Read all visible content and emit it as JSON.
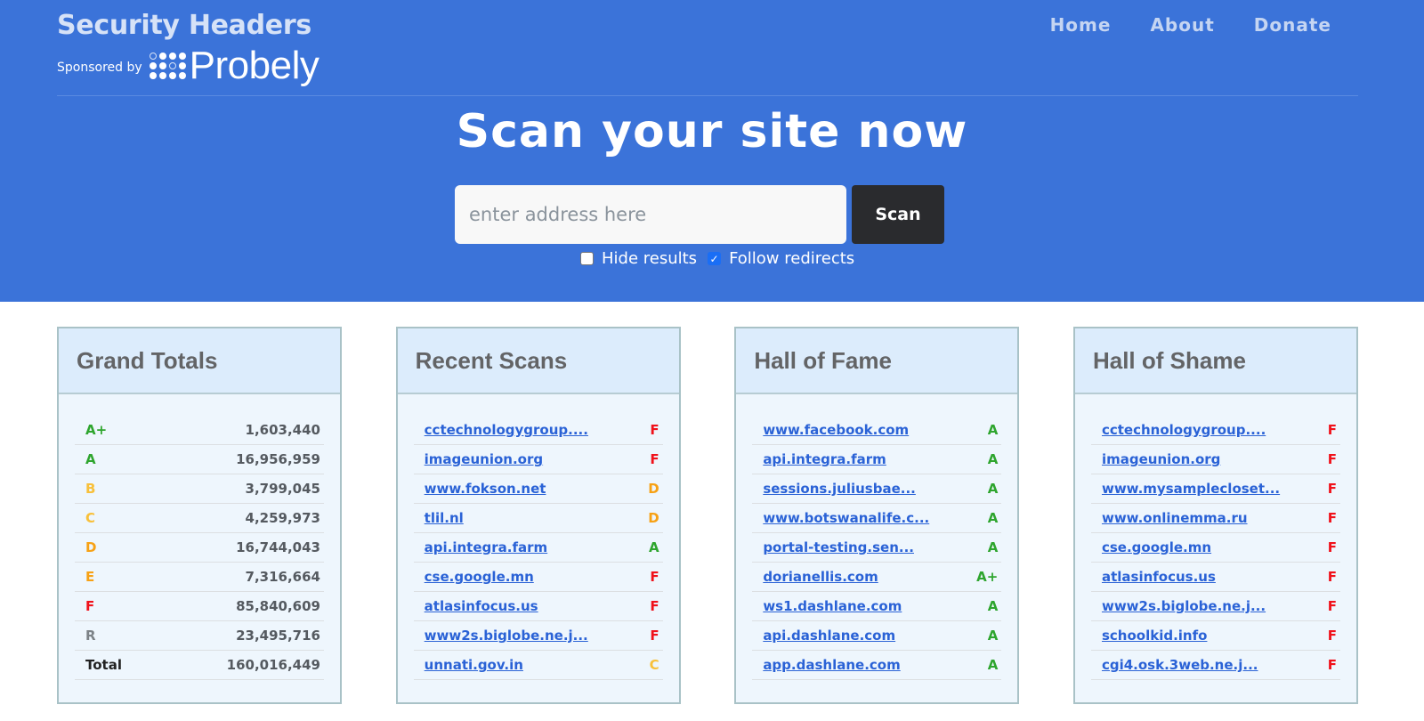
{
  "header": {
    "title": "Security Headers",
    "sponsor_label": "Sponsored by",
    "sponsor_name": "Probely",
    "nav": [
      {
        "label": "Home"
      },
      {
        "label": "About"
      },
      {
        "label": "Donate"
      }
    ]
  },
  "hero": {
    "title": "Scan your site now",
    "input_placeholder": "enter address here",
    "input_value": "",
    "scan_label": "Scan",
    "options": [
      {
        "label": "Hide results",
        "checked": false
      },
      {
        "label": "Follow redirects",
        "checked": true
      }
    ]
  },
  "colors": {
    "hero_bg": "#3b73d9",
    "grade_green": "#2ea52e",
    "grade_yellow": "#f8c03a",
    "grade_orange": "#f7a114",
    "grade_red": "#f0111a",
    "grade_gray": "#7c8287",
    "link": "#2a62d6"
  },
  "grand_totals": {
    "title": "Grand Totals",
    "rows": [
      {
        "grade": "A+",
        "value": "1,603,440"
      },
      {
        "grade": "A",
        "value": "16,956,959"
      },
      {
        "grade": "B",
        "value": "3,799,045"
      },
      {
        "grade": "C",
        "value": "4,259,973"
      },
      {
        "grade": "D",
        "value": "16,744,043"
      },
      {
        "grade": "E",
        "value": "7,316,664"
      },
      {
        "grade": "F",
        "value": "85,840,609"
      },
      {
        "grade": "R",
        "value": "23,495,716"
      }
    ],
    "total_label": "Total",
    "total_value": "160,016,449"
  },
  "recent_scans": {
    "title": "Recent Scans",
    "rows": [
      {
        "site": "cctechnologygroup....",
        "grade": "F"
      },
      {
        "site": "imageunion.org",
        "grade": "F"
      },
      {
        "site": "www.fokson.net",
        "grade": "D"
      },
      {
        "site": "tlil.nl",
        "grade": "D"
      },
      {
        "site": "api.integra.farm",
        "grade": "A"
      },
      {
        "site": "cse.google.mn",
        "grade": "F"
      },
      {
        "site": "atlasinfocus.us",
        "grade": "F"
      },
      {
        "site": "www2s.biglobe.ne.j...",
        "grade": "F"
      },
      {
        "site": "unnati.gov.in",
        "grade": "C"
      }
    ]
  },
  "hall_of_fame": {
    "title": "Hall of Fame",
    "rows": [
      {
        "site": "www.facebook.com",
        "grade": "A"
      },
      {
        "site": "api.integra.farm",
        "grade": "A"
      },
      {
        "site": "sessions.juliusbae...",
        "grade": "A"
      },
      {
        "site": "www.botswanalife.c...",
        "grade": "A"
      },
      {
        "site": "portal-testing.sen...",
        "grade": "A"
      },
      {
        "site": "dorianellis.com",
        "grade": "A+"
      },
      {
        "site": "ws1.dashlane.com",
        "grade": "A"
      },
      {
        "site": "api.dashlane.com",
        "grade": "A"
      },
      {
        "site": "app.dashlane.com",
        "grade": "A"
      }
    ]
  },
  "hall_of_shame": {
    "title": "Hall of Shame",
    "rows": [
      {
        "site": "cctechnologygroup....",
        "grade": "F"
      },
      {
        "site": "imageunion.org",
        "grade": "F"
      },
      {
        "site": "www.mysamplecloset...",
        "grade": "F"
      },
      {
        "site": "www.onlinemma.ru",
        "grade": "F"
      },
      {
        "site": "cse.google.mn",
        "grade": "F"
      },
      {
        "site": "atlasinfocus.us",
        "grade": "F"
      },
      {
        "site": "www2s.biglobe.ne.j...",
        "grade": "F"
      },
      {
        "site": "schoolkid.info",
        "grade": "F"
      },
      {
        "site": "cgi4.osk.3web.ne.j...",
        "grade": "F"
      }
    ]
  }
}
